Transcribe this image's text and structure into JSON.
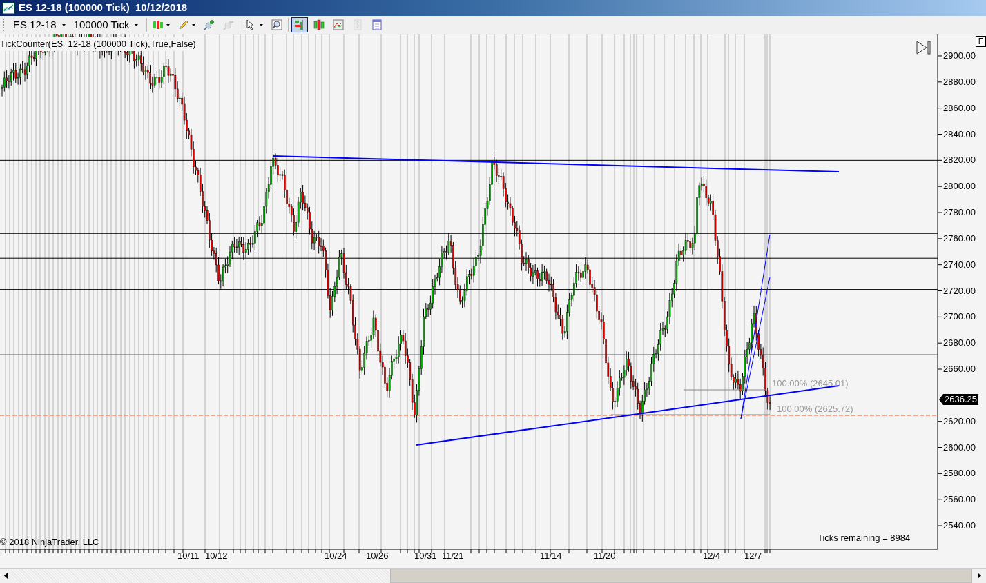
{
  "window": {
    "title": "ES 12-18 (100000 Tick)  10/12/2018"
  },
  "toolbar": {
    "instrument": "ES 12-18",
    "period": "100000 Tick",
    "buttons": [
      {
        "kind": "candles",
        "selected": false,
        "disabled": false
      },
      {
        "kind": "pencil",
        "selected": false,
        "disabled": false
      },
      {
        "kind": "zoom-in",
        "selected": false,
        "disabled": false
      },
      {
        "kind": "zoom-out",
        "selected": false,
        "disabled": true
      },
      {
        "kind": "pointer",
        "selected": false,
        "disabled": false
      },
      {
        "kind": "magnifier",
        "selected": false,
        "disabled": false
      },
      {
        "kind": "box-chart",
        "selected": true,
        "disabled": false
      },
      {
        "kind": "bars",
        "selected": false,
        "disabled": false
      },
      {
        "kind": "line-chart",
        "selected": false,
        "disabled": false
      },
      {
        "kind": "dollar",
        "selected": false,
        "disabled": true
      },
      {
        "kind": "document",
        "selected": false,
        "disabled": false
      }
    ]
  },
  "chart": {
    "indicator_label": "TickCounter(ES  12-18 (100000 Tick),True,False)",
    "y_axis": [
      "2900.00",
      "2880.00",
      "2860.00",
      "2840.00",
      "2820.00",
      "2800.00",
      "2780.00",
      "2760.00",
      "2740.00",
      "2720.00",
      "2700.00",
      "2680.00",
      "2660.00",
      "2620.00",
      "2600.00",
      "2580.00",
      "2560.00",
      "2540.00"
    ],
    "x_axis": [
      "10/11",
      "10/12",
      "10/24",
      "10/26",
      "10/31",
      "11/21",
      "11/14",
      "11/20",
      "12/4",
      "12/7"
    ],
    "fib_labels": [
      "100.00% (2645.01)",
      "100.00% (2625.72)"
    ],
    "last_price": "2636.25",
    "copyright": "© 2018 NinjaTrader, LLC",
    "ticks_remaining": "Ticks remaining = 8984",
    "corner_button": "F"
  }
}
